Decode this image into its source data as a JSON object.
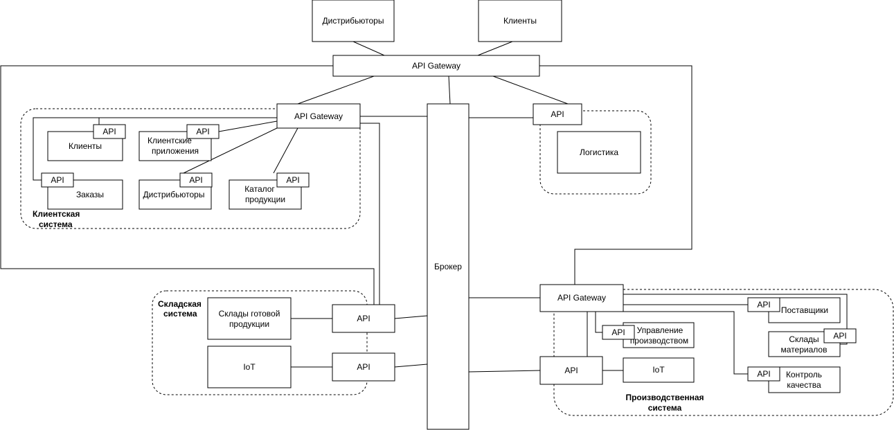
{
  "external": {
    "distributors": "Дистрибьюторы",
    "clients": "Клиенты"
  },
  "main_gateway": "API Gateway",
  "broker": "Брокер",
  "client_system": {
    "label": [
      "Клиентская",
      "система"
    ],
    "gateway": "API Gateway",
    "api": "API",
    "clients": "Клиенты",
    "client_apps": [
      "Клиентские",
      "приложения"
    ],
    "orders": "Заказы",
    "distributors": "Дистрибьюторы",
    "catalog": [
      "Каталог",
      "продукции"
    ]
  },
  "logistics": {
    "api": "API",
    "name": "Логистика"
  },
  "warehouse_system": {
    "label": [
      "Складская",
      "система"
    ],
    "finished_goods": [
      "Склады готовой",
      "продукции"
    ],
    "iot": "IoT",
    "api": "API"
  },
  "production_system": {
    "label": [
      "Производственная",
      "система"
    ],
    "gateway": "API Gateway",
    "api": "API",
    "iot": "IoT",
    "production_mgmt": [
      "Управление",
      "производством"
    ],
    "suppliers": "Поставщики",
    "material_warehouses": [
      "Склады",
      "материалов"
    ],
    "quality_control": [
      "Контроль",
      "качества"
    ]
  }
}
